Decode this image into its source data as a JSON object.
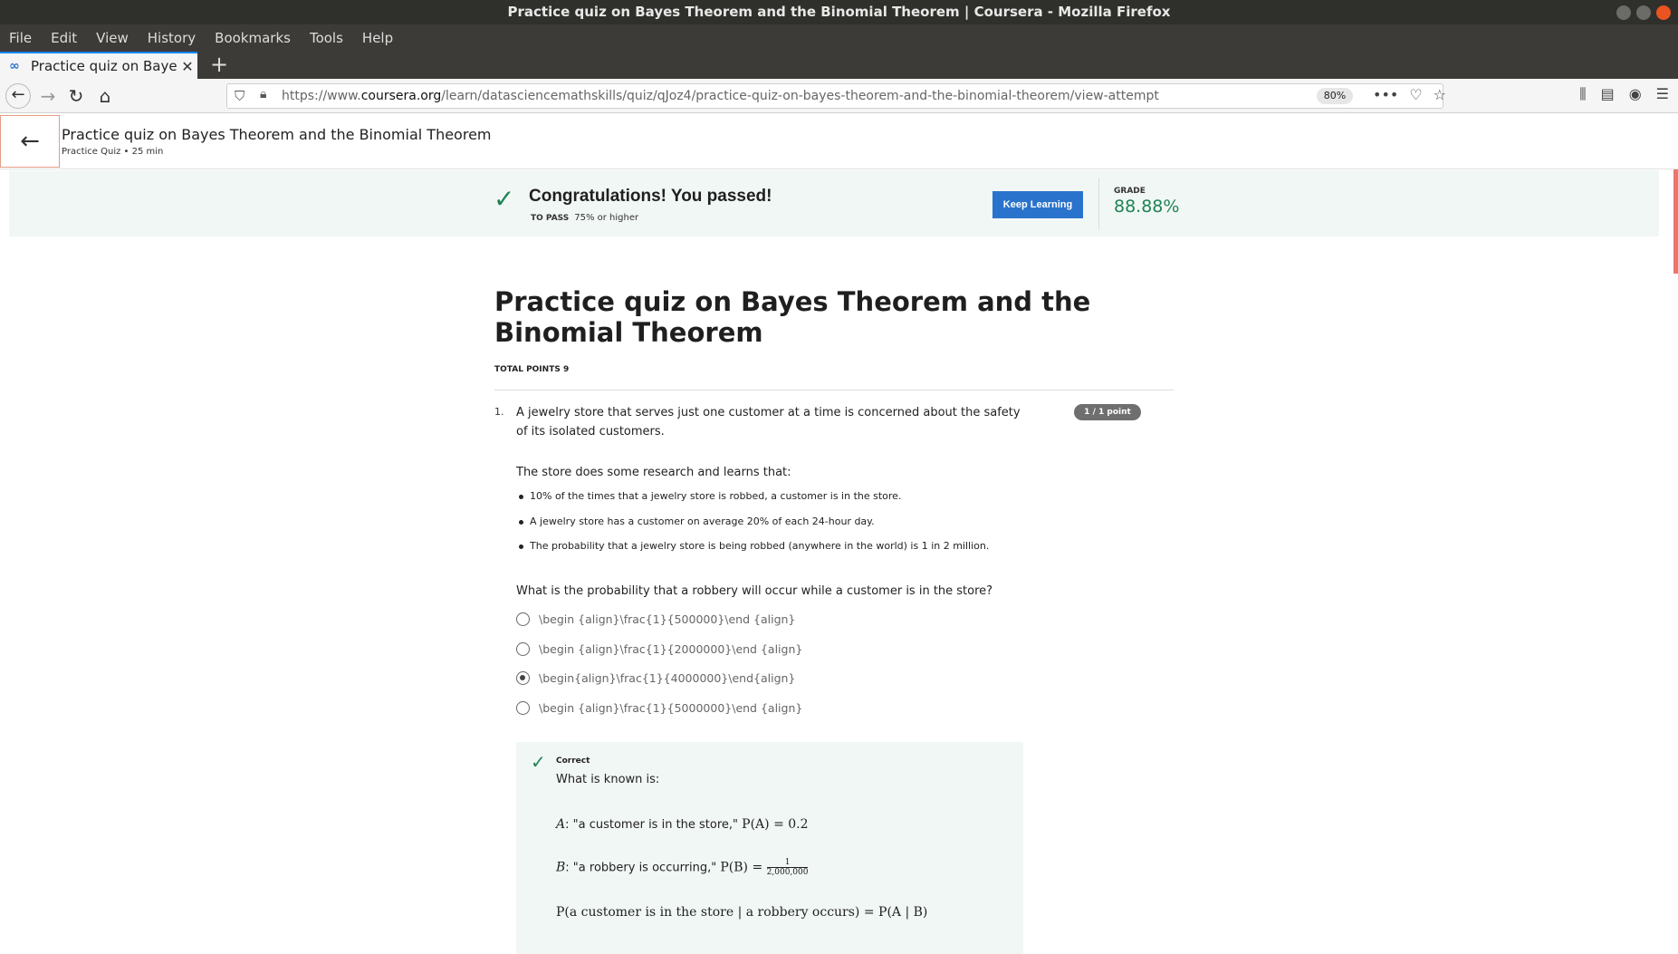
{
  "window": {
    "title": "Practice quiz on Bayes Theorem and the Binomial Theorem | Coursera - Mozilla Firefox"
  },
  "menu": [
    "File",
    "Edit",
    "View",
    "History",
    "Bookmarks",
    "Tools",
    "Help"
  ],
  "tab": {
    "title": "Practice quiz on Bayes Th",
    "icon": "coursera-logo-icon",
    "close_glyph": "✕",
    "new_tab_glyph": "+"
  },
  "navbar": {
    "url_prefix": "https://www.",
    "url_domain": "coursera.org",
    "url_path": "/learn/datasciencemathskills/quiz/qJoz4/practice-quiz-on-bayes-theorem-and-the-binomial-theorem/view-attempt",
    "zoom": "80%"
  },
  "header": {
    "title": "Practice quiz on Bayes Theorem and the Binomial Theorem",
    "subtitle": "Practice Quiz • 25 min"
  },
  "banner": {
    "message": "Congratulations! You passed!",
    "to_pass_label": "TO PASS",
    "to_pass_value": "75% or higher",
    "button_label": "Keep Learning",
    "grade_label": "GRADE",
    "grade_value": "88.88%",
    "accent_color": "#1f8354",
    "button_color": "#2a73cc"
  },
  "quiz": {
    "title": "Practice quiz on Bayes Theorem and the Binomial Theorem",
    "total_points": "TOTAL POINTS 9",
    "question": {
      "number": "1.",
      "text": "A jewelry store that serves just one customer at a time is concerned about the safety of its isolated customers.",
      "points": "1 / 1 point",
      "research_intro": "The store does some research and learns that:",
      "facts": [
        "10% of the times that a jewelry store is robbed, a customer is in the store.",
        "A jewelry store has a customer on average 20% of each 24-hour day.",
        "The probability that a jewelry store is being robbed (anywhere in the world) is 1 in 2 million."
      ],
      "prompt": "What is the probability that a robbery will occur while a customer is in the store?",
      "options": [
        {
          "label": "\\begin {align}\\frac{1}{500000}\\end {align}",
          "selected": false
        },
        {
          "label": "\\begin {align}\\frac{1}{2000000}\\end {align}",
          "selected": false
        },
        {
          "label": "\\begin{align}\\frac{1}{4000000}\\end{align}",
          "selected": true
        },
        {
          "label": "\\begin {align}\\frac{1}{5000000}\\end {align}",
          "selected": false
        }
      ]
    },
    "feedback": {
      "status": "Correct",
      "known": "What is known is:",
      "a_var": "A",
      "a_text": ": \"a customer is in the store,\" ",
      "a_prob": "P(A) = 0.2",
      "b_var": "B",
      "b_text": ": \"a robbery is occurring,\" ",
      "b_prob": "P(B) = ",
      "b_num": "1",
      "b_den": "2,000,000",
      "cond_text": "P(a customer is in the store | a robbery occurs) = P(A | B)"
    }
  }
}
